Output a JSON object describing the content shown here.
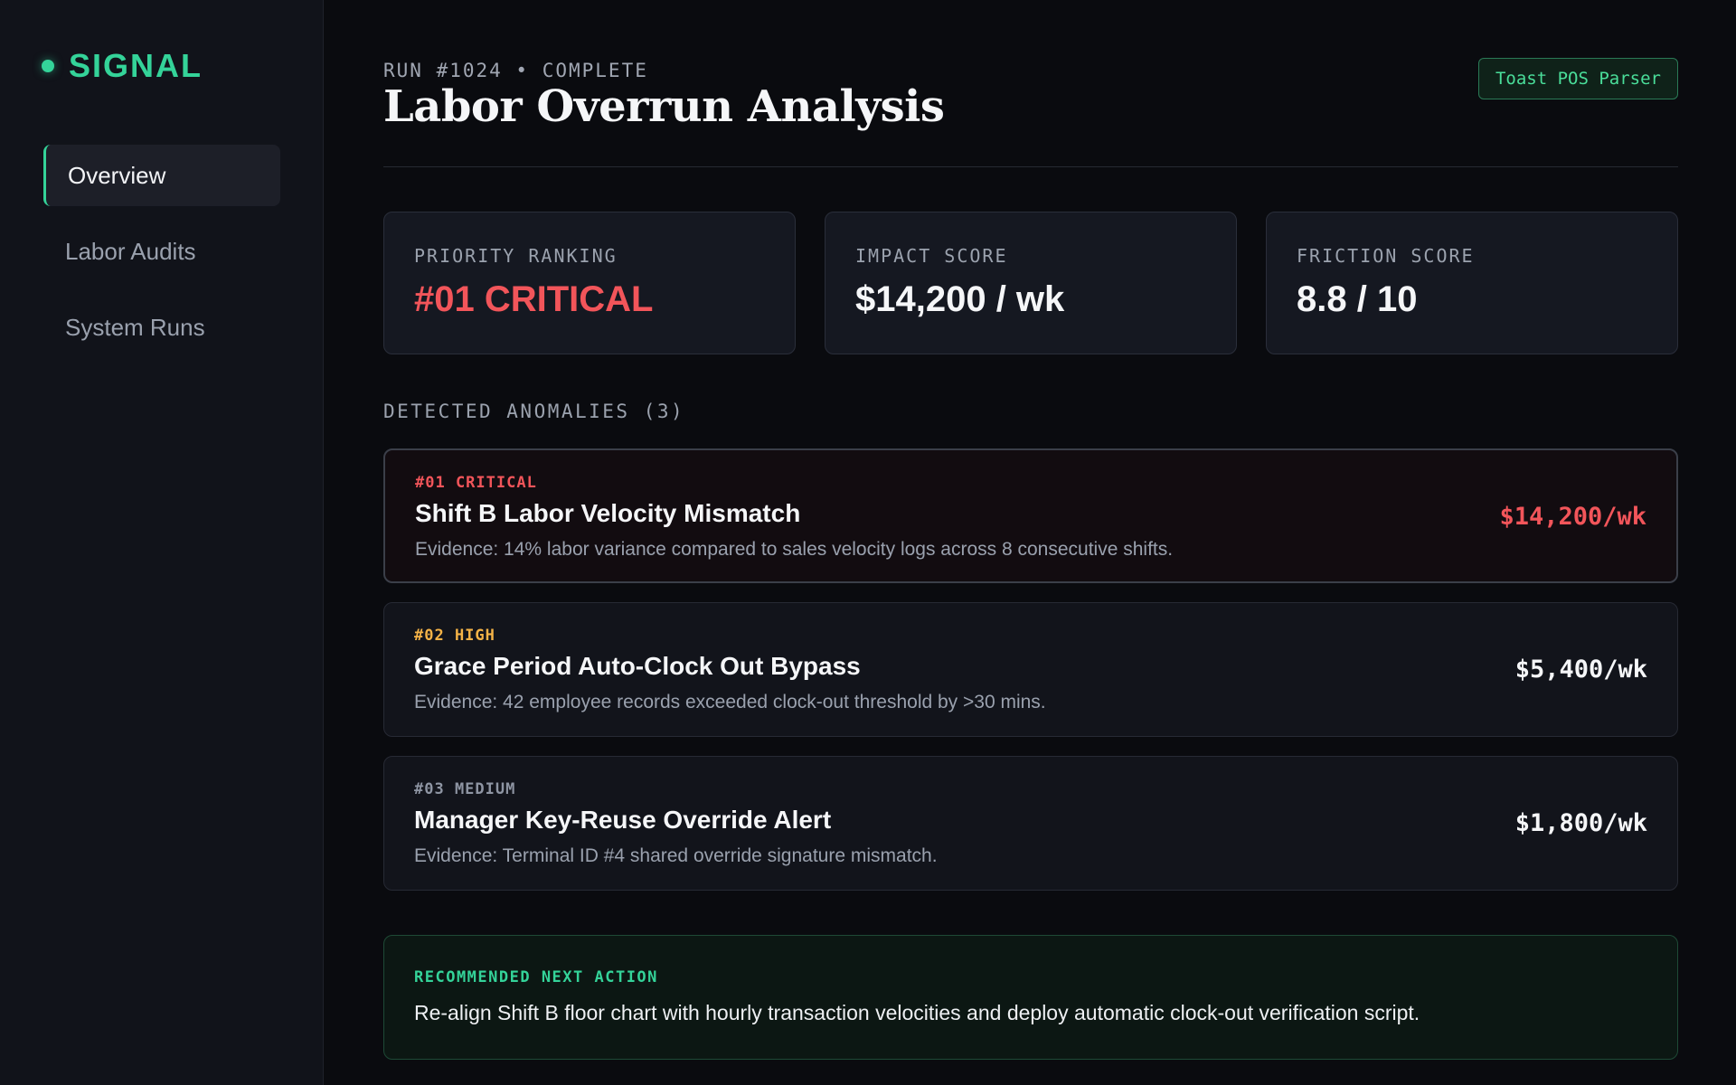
{
  "brand": {
    "name": "SIGNAL",
    "accent": "#34d399"
  },
  "nav": {
    "items": [
      {
        "label": "Overview",
        "active": true
      },
      {
        "label": "Labor Audits",
        "active": false
      },
      {
        "label": "System Runs",
        "active": false
      }
    ]
  },
  "header": {
    "run_label": "RUN #1024 • COMPLETE",
    "title": "Labor Overrun Analysis",
    "badge": "Toast POS Parser"
  },
  "metrics": [
    {
      "label": "PRIORITY RANKING",
      "value": "#01 CRITICAL",
      "color": "#f2555a"
    },
    {
      "label": "IMPACT SCORE",
      "value": "$14,200 / wk"
    },
    {
      "label": "FRICTION SCORE",
      "value": "8.8 / 10"
    }
  ],
  "anomalies": {
    "section_label": "DETECTED ANOMALIES (3)",
    "items": [
      {
        "tag": "#01 CRITICAL",
        "title": "Shift B Labor Velocity Mismatch",
        "evidence": "Evidence: 14% labor variance compared to sales velocity logs across 8 consecutive shifts.",
        "amount": "$14,200/wk",
        "color": "#f2555a"
      },
      {
        "tag": "#02 HIGH",
        "title": "Grace Period Auto-Clock Out Bypass",
        "evidence": "Evidence: 42 employee records exceeded clock-out threshold by >30 mins.",
        "amount": "$5,400/wk",
        "color": "#f5b347"
      },
      {
        "tag": "#03 MEDIUM",
        "title": "Manager Key-Reuse Override Alert",
        "evidence": "Evidence: Terminal ID #4 shared override signature mismatch.",
        "amount": "$1,800/wk",
        "color": "#8e95a3"
      }
    ]
  },
  "recommendation": {
    "label": "RECOMMENDED NEXT ACTION",
    "text": "Re-align Shift B floor chart with hourly transaction velocities and deploy automatic clock-out verification script."
  }
}
